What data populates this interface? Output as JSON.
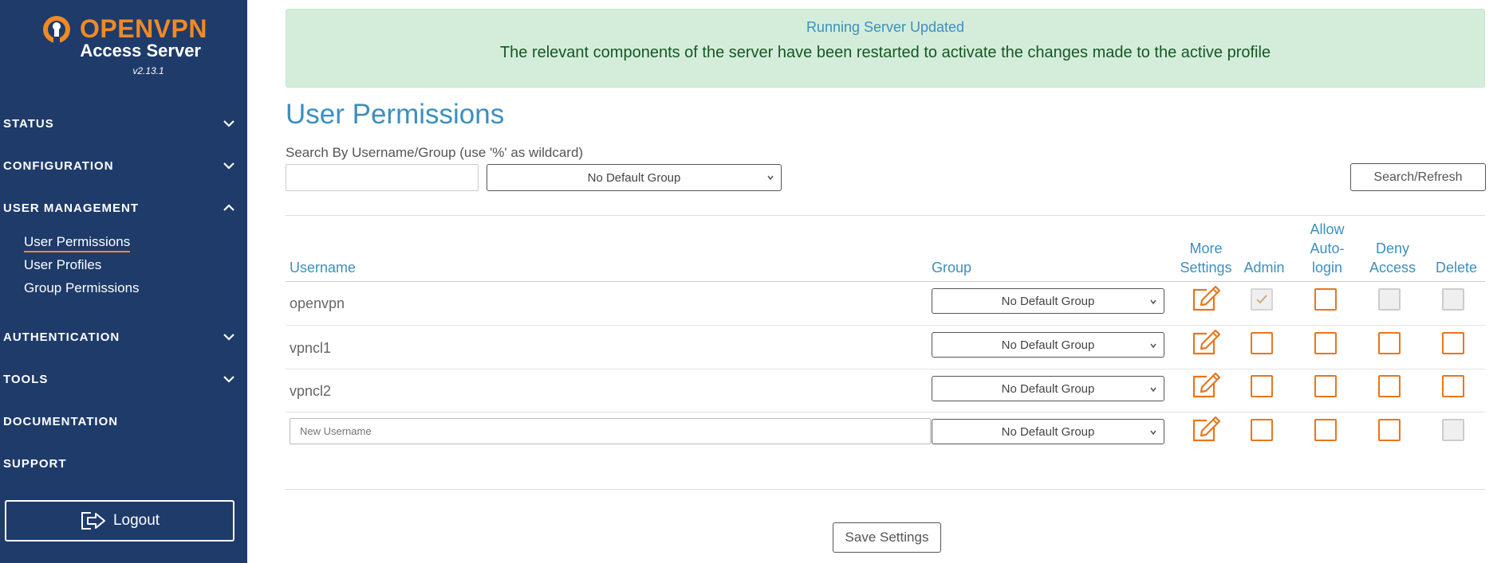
{
  "brand": {
    "name": "OPENVPN",
    "product": "Access Server",
    "version": "v2.13.1"
  },
  "sidebar": {
    "items": [
      {
        "label": "STATUS",
        "icon": "chevron-down-icon"
      },
      {
        "label": "CONFIGURATION",
        "icon": "chevron-down-icon"
      },
      {
        "label": "USER  MANAGEMENT",
        "icon": "chevron-up-icon"
      },
      {
        "label": "AUTHENTICATION",
        "icon": "chevron-down-icon"
      },
      {
        "label": "TOOLS",
        "icon": "chevron-down-icon"
      },
      {
        "label": "DOCUMENTATION"
      },
      {
        "label": "SUPPORT"
      }
    ],
    "sub_items": [
      {
        "label": "User Permissions",
        "active": true
      },
      {
        "label": "User Profiles"
      },
      {
        "label": "Group Permissions"
      }
    ],
    "logout_label": "Logout"
  },
  "alert": {
    "title": "Running Server Updated",
    "message": "The relevant components of the server have been restarted to activate the changes made to the active profile"
  },
  "page": {
    "title": "User Permissions",
    "search_label": "Search By Username/Group (use '%' as wildcard)",
    "search_value": "",
    "group_filter": "No Default Group",
    "search_button": "Search/Refresh"
  },
  "table": {
    "headers": {
      "username": "Username",
      "group": "Group",
      "more_settings": [
        "More",
        "Settings"
      ],
      "admin": "Admin",
      "auto_login": [
        "Allow",
        "Auto-",
        "login"
      ],
      "deny": [
        "Deny",
        "Access"
      ],
      "delete": "Delete"
    },
    "rows": [
      {
        "username": "openvpn",
        "group": "No Default Group",
        "admin": "checked-disabled",
        "auto_login": "unchecked",
        "deny": "disabled",
        "delete": "disabled"
      },
      {
        "username": "vpncl1",
        "group": "No Default Group",
        "admin": "unchecked",
        "auto_login": "unchecked",
        "deny": "unchecked",
        "delete": "unchecked"
      },
      {
        "username": "vpncl2",
        "group": "No Default Group",
        "admin": "unchecked",
        "auto_login": "unchecked",
        "deny": "unchecked",
        "delete": "unchecked"
      }
    ],
    "new_row": {
      "placeholder": "New Username",
      "group": "No Default Group",
      "admin": "unchecked",
      "auto_login": "unchecked",
      "deny": "unchecked",
      "delete": "disabled"
    }
  },
  "save_button": "Save Settings",
  "colors": {
    "sidebar_bg": "#1e3b6a",
    "accent_orange": "#e8761d",
    "heading_blue": "#3d8fbf",
    "alert_bg": "#d4edda"
  }
}
